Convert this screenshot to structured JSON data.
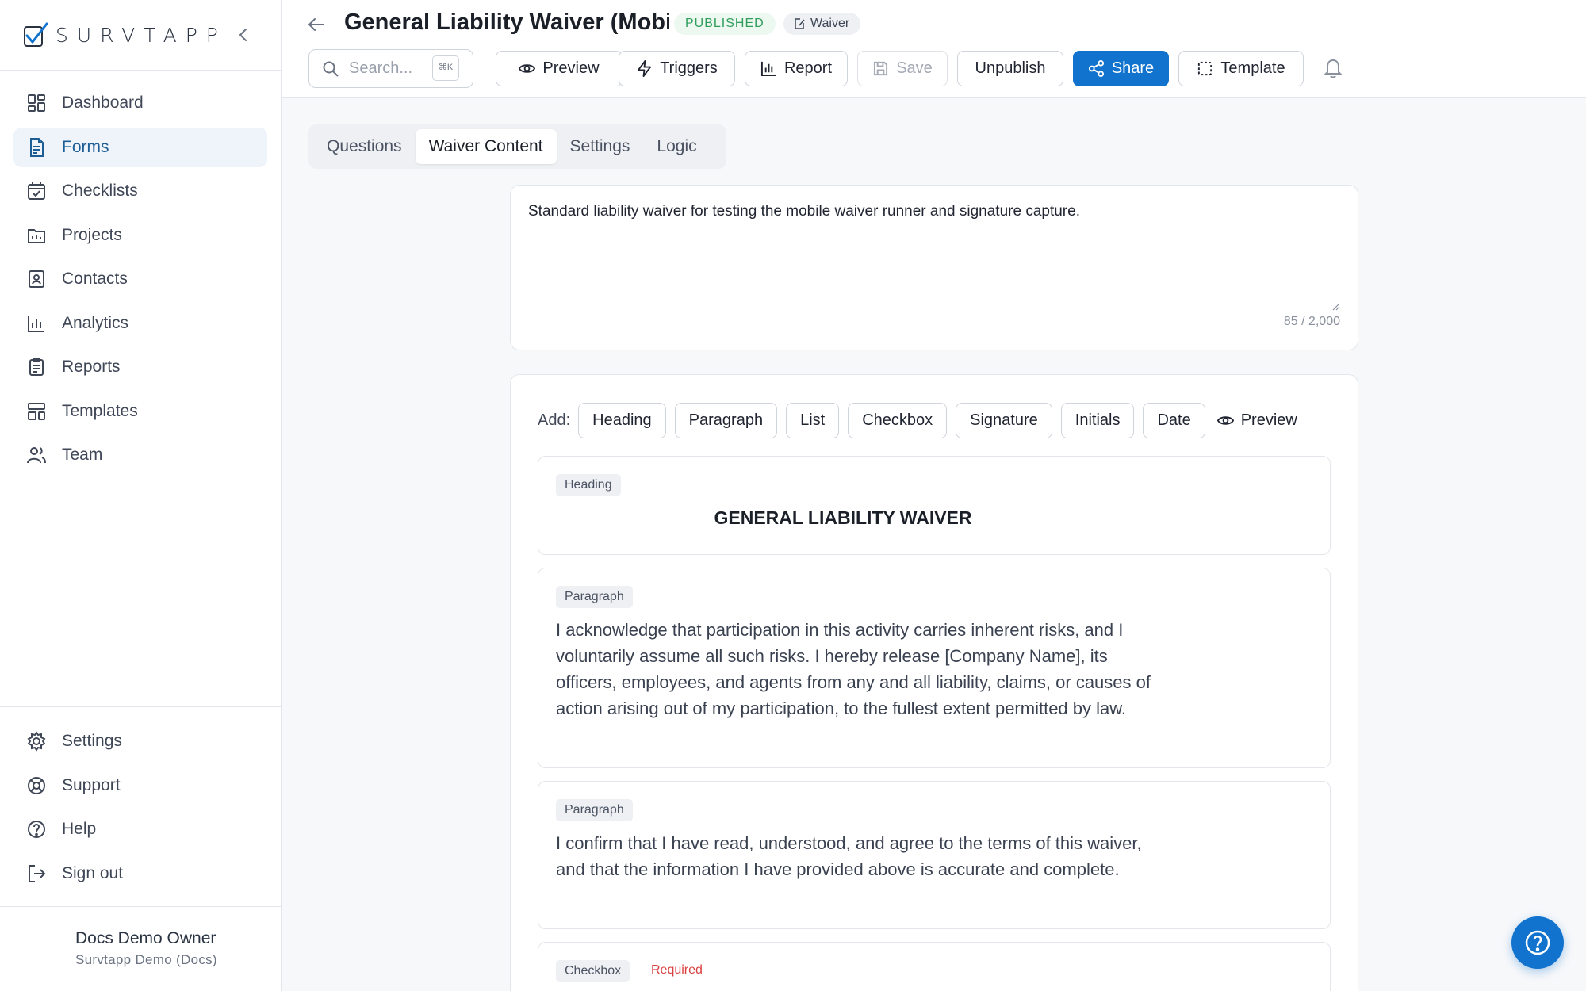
{
  "brand": {
    "name": "SURVTAPP"
  },
  "sidebar": {
    "items": [
      {
        "label": "Dashboard",
        "icon": "dashboard-icon"
      },
      {
        "label": "Forms",
        "icon": "forms-icon",
        "active": true
      },
      {
        "label": "Checklists",
        "icon": "checklists-icon"
      },
      {
        "label": "Projects",
        "icon": "projects-icon"
      },
      {
        "label": "Contacts",
        "icon": "contacts-icon"
      },
      {
        "label": "Analytics",
        "icon": "analytics-icon"
      },
      {
        "label": "Reports",
        "icon": "reports-icon"
      },
      {
        "label": "Templates",
        "icon": "templates-icon"
      },
      {
        "label": "Team",
        "icon": "team-icon"
      }
    ],
    "bottom_items": [
      {
        "label": "Settings",
        "icon": "gear-icon"
      },
      {
        "label": "Support",
        "icon": "lifebuoy-icon"
      },
      {
        "label": "Help",
        "icon": "help-circle-icon"
      },
      {
        "label": "Sign out",
        "icon": "sign-out-icon"
      }
    ],
    "user": {
      "name": "Docs Demo Owner",
      "org": "Survtapp Demo (Docs)"
    }
  },
  "header": {
    "title": "General Liability Waiver (Mobi",
    "status_badge": "PUBLISHED",
    "type_badge": "Waiver",
    "search": {
      "placeholder": "Search...",
      "shortcut": "⌘K"
    },
    "buttons": {
      "preview": "Preview",
      "triggers": "Triggers",
      "report": "Report",
      "save": "Save",
      "unpublish": "Unpublish",
      "share": "Share",
      "template": "Template"
    }
  },
  "tabs": [
    "Questions",
    "Waiver Content",
    "Settings",
    "Logic"
  ],
  "active_tab": "Waiver Content",
  "description": {
    "value": "Standard liability waiver for testing the mobile waiver runner and signature capture.",
    "count": "85 / 2,000"
  },
  "builder": {
    "add_label": "Add:",
    "add_options": [
      "Heading",
      "Paragraph",
      "List",
      "Checkbox",
      "Signature",
      "Initials",
      "Date"
    ],
    "preview_label": "Preview",
    "blocks": [
      {
        "type": "Heading",
        "text": "GENERAL LIABILITY WAIVER"
      },
      {
        "type": "Paragraph",
        "text": "I acknowledge that participation in this activity carries inherent risks, and I voluntarily assume all such risks. I hereby release [Company Name], its officers, employees, and agents from any and all liability, claims, or causes of action arising out of my participation, to the fullest extent permitted by law."
      },
      {
        "type": "Paragraph",
        "text": "I confirm that I have read, understood, and agree to the terms of this waiver, and that the information I have provided above is accurate and complete."
      },
      {
        "type": "Checkbox",
        "required_label": "Required"
      }
    ]
  },
  "colors": {
    "accent": "#1173cd",
    "published": "#2e9d5a",
    "required": "#d94141",
    "active_nav_bg": "#eef4fa"
  }
}
